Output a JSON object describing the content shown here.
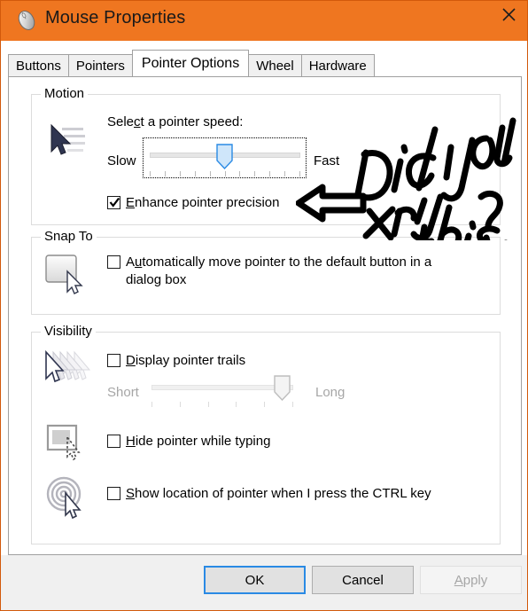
{
  "window": {
    "title": "Mouse Properties",
    "title_icon": "mouse-icon",
    "close_icon": "close-icon",
    "accent_color": "#ef7620",
    "border_color": "#d2590b"
  },
  "tabs": [
    {
      "label": "Buttons",
      "active": false
    },
    {
      "label": "Pointers",
      "active": false
    },
    {
      "label": "Pointer Options",
      "active": true
    },
    {
      "label": "Wheel",
      "active": false
    },
    {
      "label": "Hardware",
      "active": false
    }
  ],
  "motion": {
    "group_label": "Motion",
    "icon": "pointer-speed-icon",
    "speed_caption_pre": "Sele",
    "speed_caption_accel": "c",
    "speed_caption_post": "t a pointer speed:",
    "slow_label": "Slow",
    "fast_label": "Fast",
    "slider": {
      "min": 1,
      "max": 11,
      "value": 6,
      "ticks": 11,
      "focused": true,
      "enabled": true
    },
    "enhance": {
      "accel": "E",
      "label_rest": "nhance pointer precision",
      "checked": true
    }
  },
  "snap_to": {
    "group_label": "Snap To",
    "icon": "snap-to-button-icon",
    "auto_move": {
      "pre": "A",
      "accel": "u",
      "label_rest": "tomatically move pointer to the default button in a",
      "line2": "dialog box",
      "checked": false
    }
  },
  "visibility": {
    "group_label": "Visibility",
    "trails": {
      "icon": "pointer-trails-icon",
      "accel": "D",
      "label_rest": "isplay pointer trails",
      "checked": false,
      "short_label": "Short",
      "long_label": "Long",
      "slider": {
        "min": 1,
        "max": 6,
        "value": 5,
        "ticks": 6,
        "enabled": false
      }
    },
    "hide_typing": {
      "icon": "hide-pointer-typing-icon",
      "accel": "H",
      "label_rest": "ide pointer while typing",
      "checked": false
    },
    "show_location": {
      "icon": "ctrl-key-locate-icon",
      "accel": "S",
      "label_rest": "how location of pointer when I press the CTRL key",
      "checked": false
    }
  },
  "buttons": {
    "ok": "OK",
    "cancel": "Cancel",
    "apply_accel": "A",
    "apply_rest": "pply",
    "apply_enabled": false,
    "default_focus": "ok"
  },
  "annotation": {
    "text": "Did you try this?",
    "arrow": "left-arrow-annotation",
    "color": "#000000"
  }
}
